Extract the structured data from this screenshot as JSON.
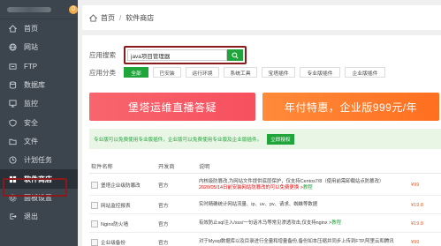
{
  "sidebar": {
    "badge": "0",
    "items": [
      {
        "label": "首页",
        "icon": "home-icon"
      },
      {
        "label": "网站",
        "icon": "globe-icon"
      },
      {
        "label": "FTP",
        "icon": "ftp-icon"
      },
      {
        "label": "数据库",
        "icon": "database-icon"
      },
      {
        "label": "监控",
        "icon": "monitor-icon"
      },
      {
        "label": "安全",
        "icon": "shield-icon"
      },
      {
        "label": "文件",
        "icon": "folder-icon"
      },
      {
        "label": "计划任务",
        "icon": "clock-icon"
      },
      {
        "label": "软件商店",
        "icon": "store-icon"
      },
      {
        "label": "面板设置",
        "icon": "gear-icon"
      },
      {
        "label": "退出",
        "icon": "logout-icon"
      }
    ]
  },
  "breadcrumb": {
    "home": "首页",
    "current": "软件商店"
  },
  "search": {
    "label": "应用搜索",
    "value": "java项目管理器"
  },
  "categories": {
    "label": "应用分类",
    "items": [
      "全部",
      "已安装",
      "运行环境",
      "系统工具",
      "宝塔插件",
      "专业版插件",
      "企业版插件"
    ]
  },
  "banners": {
    "left": "堡塔运维直播答疑",
    "right": "年付特惠，企业版999元/年"
  },
  "notice": {
    "text": "专业版可以免费使用专业版插件，企业版可以免费使用专业版及企业版插件。",
    "button": "立即授权"
  },
  "table": {
    "headers": [
      "软件名称",
      "开发商",
      "说明"
    ],
    "rows": [
      {
        "name": "堡塔企业级防篡改",
        "dev": "官方",
        "desc1": "内核级防篡改,为网站文件提供底层保护，仅支持Centos7/8（使用前需卸载站点防篡改）",
        "desc2": "2020/05/14日前安装网站防篡改的可以免费更换 >",
        "desc_link": "教程",
        "price": "¥99"
      },
      {
        "name": "网站监控报表",
        "dev": "官方",
        "desc1": "实时精确统计网站流量、ip、uv、pv、请求、蜘蛛等数据",
        "desc2": "",
        "desc_link": "",
        "price": "¥19.8"
      },
      {
        "name": "Nginx防火墙",
        "dev": "官方",
        "desc1": "有效防止sql注入/xss/一句话木马等常见渗透攻击,仅支持nginx >",
        "desc2": "",
        "desc_link": "教程",
        "price": "¥19.8"
      },
      {
        "name": "企业级备份",
        "dev": "官方",
        "desc1": "对于Mysql数据库以及目录进行全量和增量备份,备份如本压缩并同步上传到FTP,阿里云和腾讯",
        "desc2": "",
        "desc_link": "",
        "price": "¥99"
      }
    ]
  }
}
